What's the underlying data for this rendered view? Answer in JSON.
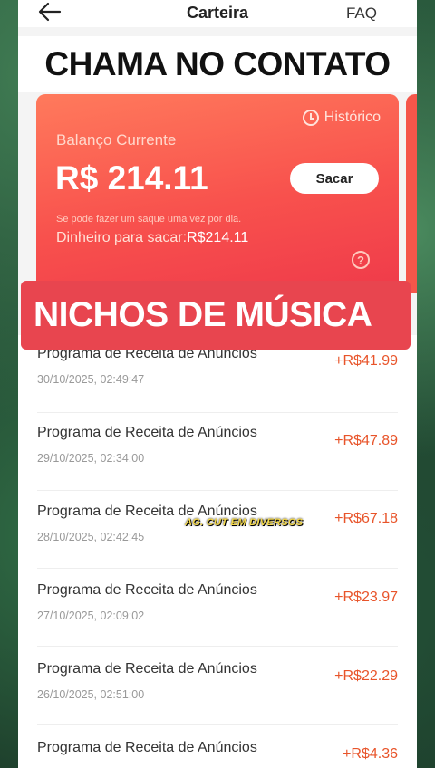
{
  "header": {
    "title": "Carteira",
    "faq": "FAQ"
  },
  "overlay_top": "CHAMA NO CONTATO",
  "balance_card": {
    "history": "Histórico",
    "label": "Balanço Currente",
    "value": "R$ 214.11",
    "withdraw_button": "Sacar",
    "note": "Se pode fazer um saque uma vez por dia.",
    "available_label": "Dinheiro para sacar:",
    "available_value": "R$214.11"
  },
  "overlay_middle": "NICHOS DE MÚSICA",
  "transactions": [
    {
      "name": "Programa de Receita de Anúncios",
      "date": "30/10/2025, 02:49:47",
      "amount": "+R$41.99"
    },
    {
      "name": "Programa de Receita de Anúncios",
      "date": "29/10/2025, 02:34:00",
      "amount": "+R$47.89"
    },
    {
      "name": "Programa de Receita de Anúncios",
      "date": "28/10/2025, 02:42:45",
      "amount": "+R$67.18"
    },
    {
      "name": "Programa de Receita de Anúncios",
      "date": "27/10/2025, 02:09:02",
      "amount": "+R$23.97"
    },
    {
      "name": "Programa de Receita de Anúncios",
      "date": "26/10/2025, 02:51:00",
      "amount": "+R$22.29"
    },
    {
      "name": "Programa de Receita de Anúncios",
      "date": "",
      "amount": "+R$4.36"
    }
  ],
  "caption": "AG. CUT EM DIVERSOS"
}
